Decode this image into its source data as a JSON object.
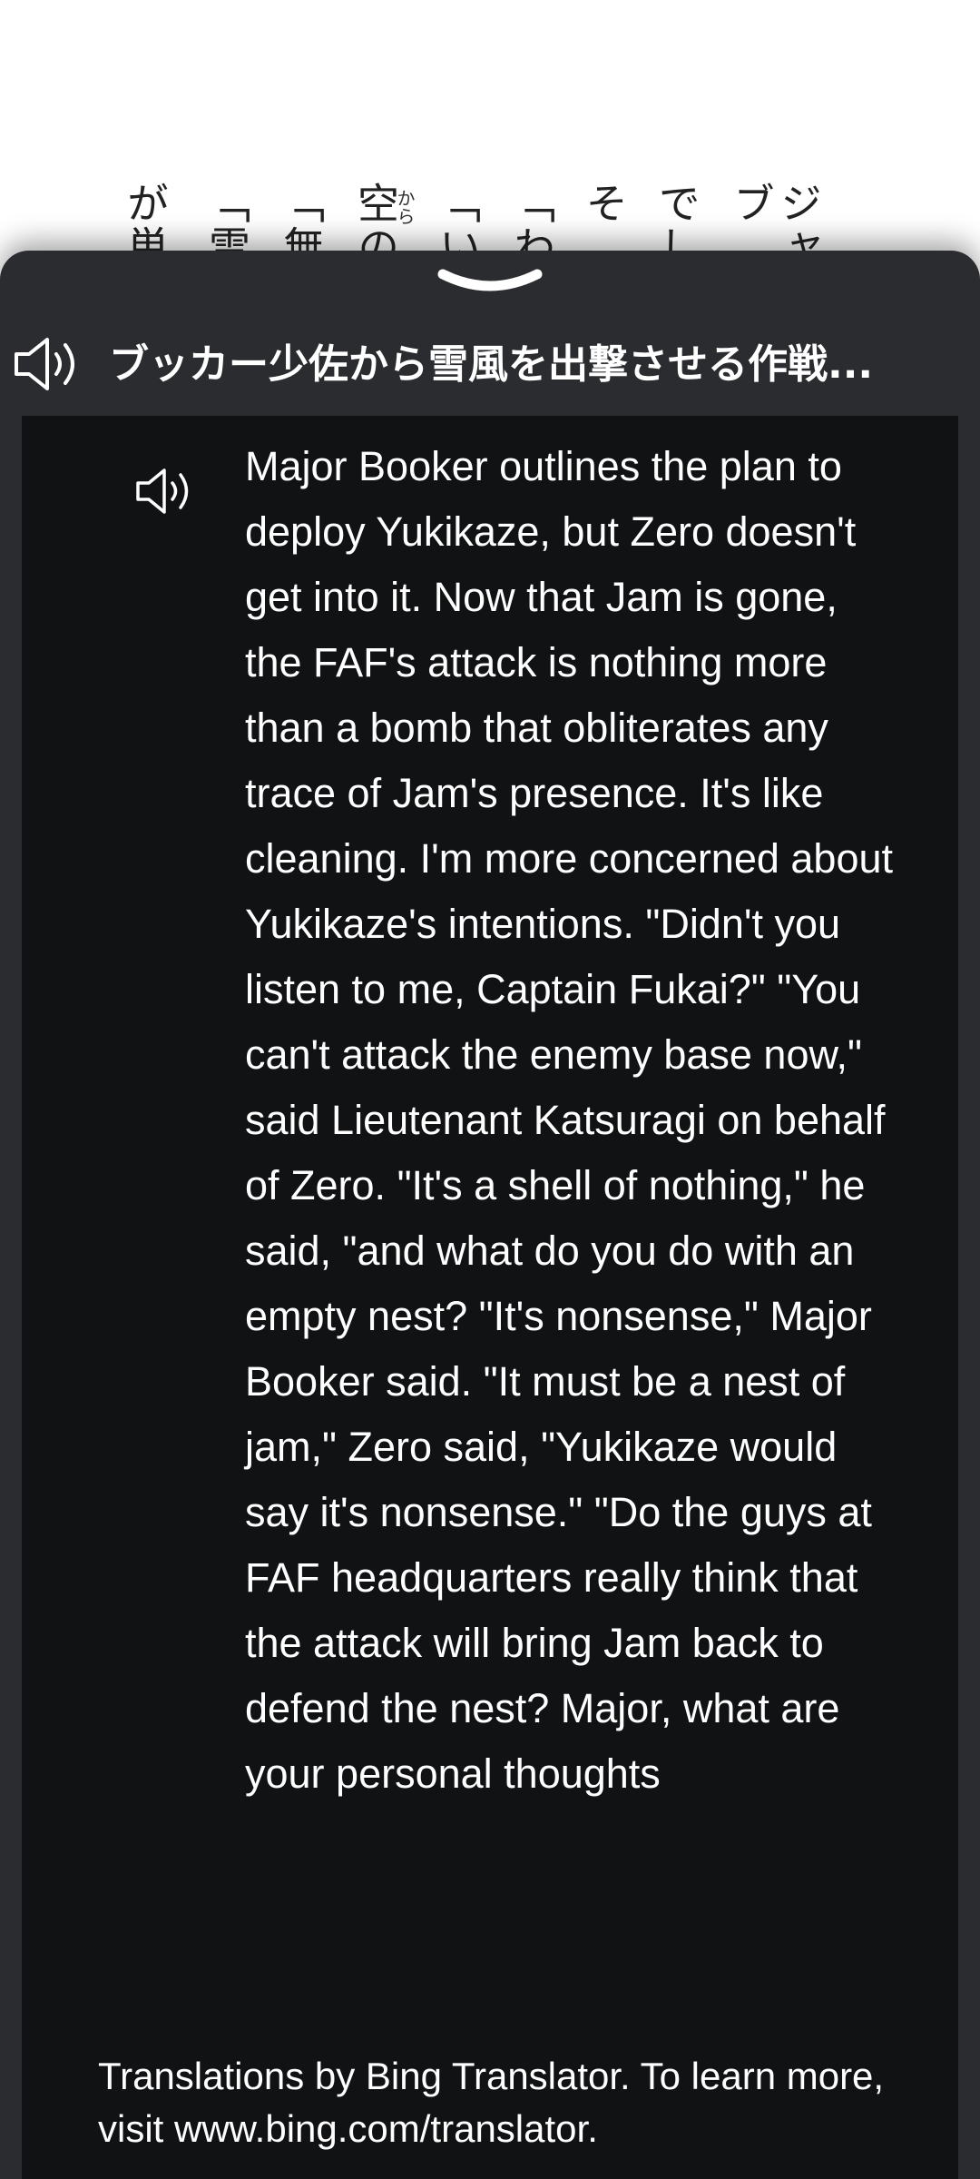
{
  "book_page": {
    "columns": [
      "ジャブ",
      "でし",
      "そ",
      "「わ",
      "「い",
      "空の",
      "「無",
      "「雪",
      "が単"
    ],
    "ruby": "から"
  },
  "sheet": {
    "handle_icon": "chevron-down-icon",
    "header": {
      "speaker_icon": "speaker-icon",
      "title": "ブッカー少佐から雪風を出撃させる作戦..."
    },
    "translation": {
      "speaker_icon": "speaker-icon",
      "text": "Major Booker outlines the plan to deploy Yukikaze, but Zero doesn't get into it. Now that Jam is gone, the FAF's attack is nothing more than a bomb that obliterates any trace of Jam's presence. It's like cleaning. I'm more concerned about Yukikaze's intentions. \"Didn't you listen to me, Captain Fukai?\" \"You can't attack the enemy base now,\" said Lieutenant Katsuragi on behalf of Zero. \"It's a shell of nothing,\" he said, \"and what do you do with an empty nest? \"It's nonsense,\" Major Booker said. \"It must be a nest of jam,\" Zero said, \"Yukikaze would say it's nonsense.\" \"Do the guys at FAF headquarters really think that the attack will bring Jam back to defend the nest? Major, what are your personal thoughts",
      "attribution": "Translations by Bing Translator. To learn more, visit www.bing.com/translator."
    }
  },
  "colors": {
    "sheet_bg": "#2b2c2f",
    "panel_bg": "#111214",
    "text": "#ffffff"
  }
}
